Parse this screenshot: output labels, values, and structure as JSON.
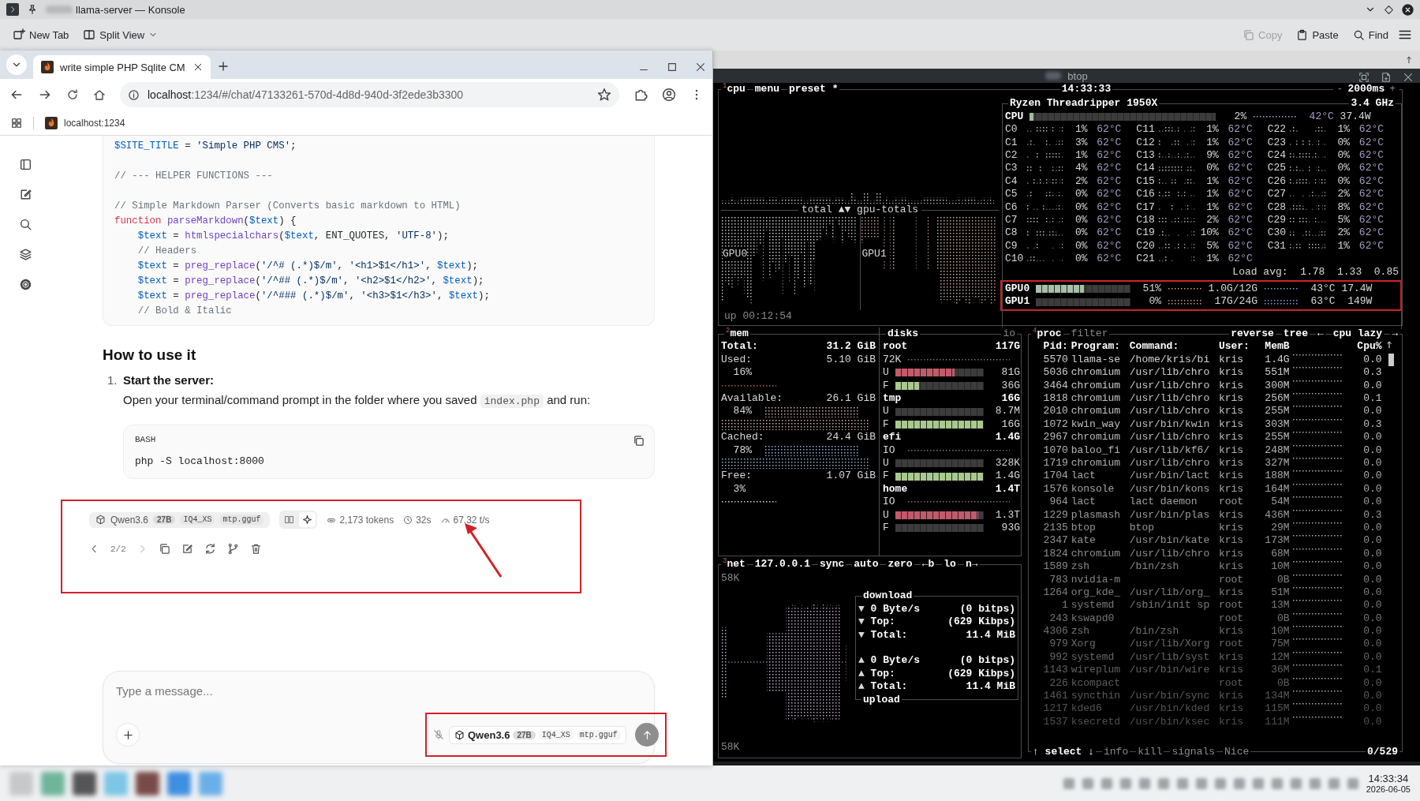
{
  "konsole": {
    "title": "llama-server — Konsole",
    "toolbar": [
      {
        "label": "New Tab",
        "kind": "new-tab"
      },
      {
        "label": "Split View",
        "kind": "split"
      }
    ],
    "actions": [
      {
        "label": "Copy",
        "kind": "copy",
        "disabled": true
      },
      {
        "label": "Paste",
        "kind": "paste",
        "disabled": false
      },
      {
        "label": "Find",
        "kind": "search",
        "disabled": false
      }
    ]
  },
  "browser": {
    "tabs": [
      {
        "title": "write simple PHP Sqlite CM",
        "selected": true
      }
    ],
    "url_host": "localhost",
    "url_path": ":1234/#/chat/47133261-570d-4d8d-940d-3f2ede3b3300",
    "bookmarks": [
      {
        "label": "localhost:1234"
      }
    ]
  },
  "sidebar": [
    {
      "kind": "panel"
    },
    {
      "kind": "edit"
    },
    {
      "kind": "search"
    },
    {
      "kind": "models"
    },
    {
      "kind": "settings"
    }
  ],
  "chat": {
    "code_lines": [
      {
        "kind": "code",
        "indented": false,
        "segments": [
          {
            "kind": "var",
            "t": "$SITE_TITLE"
          },
          {
            "kind": "p",
            "t": " = "
          },
          {
            "kind": "str",
            "t": "'Simple PHP CMS'"
          },
          {
            "kind": "p",
            "t": ";"
          }
        ]
      },
      {
        "kind": "blank"
      },
      {
        "kind": "code",
        "indented": false,
        "segments": [
          {
            "kind": "cm",
            "t": "// --- HELPER FUNCTIONS ---"
          }
        ]
      },
      {
        "kind": "blank"
      },
      {
        "kind": "code",
        "indented": false,
        "segments": [
          {
            "kind": "cm",
            "t": "// Simple Markdown Parser (Converts basic markdown to HTML)"
          }
        ]
      },
      {
        "kind": "code",
        "indented": false,
        "segments": [
          {
            "kind": "kw",
            "t": "function"
          },
          {
            "kind": "fn",
            "t": " parseMarkdown"
          },
          {
            "kind": "p",
            "t": "("
          },
          {
            "kind": "var",
            "t": "$text"
          },
          {
            "kind": "p",
            "t": ") {"
          }
        ]
      },
      {
        "kind": "code",
        "indented": true,
        "segments": [
          {
            "kind": "var",
            "t": "$text"
          },
          {
            "kind": "p",
            "t": " = "
          },
          {
            "kind": "fn",
            "t": "htmlspecialchars"
          },
          {
            "kind": "p",
            "t": "("
          },
          {
            "kind": "var",
            "t": "$text"
          },
          {
            "kind": "p",
            "t": ", ENT_QUOTES, "
          },
          {
            "kind": "str",
            "t": "'UTF-8'"
          },
          {
            "kind": "p",
            "t": ");"
          }
        ]
      },
      {
        "kind": "code",
        "indented": true,
        "segments": [
          {
            "kind": "cm",
            "t": "// Headers"
          }
        ]
      },
      {
        "kind": "code",
        "indented": true,
        "segments": [
          {
            "kind": "var",
            "t": "$text"
          },
          {
            "kind": "p",
            "t": " = "
          },
          {
            "kind": "fn",
            "t": "preg_replace"
          },
          {
            "kind": "p",
            "t": "("
          },
          {
            "kind": "str",
            "t": "'/^# (.*)$/m'"
          },
          {
            "kind": "p",
            "t": ", "
          },
          {
            "kind": "str",
            "t": "'<h1>$1</h1>'"
          },
          {
            "kind": "p",
            "t": ", "
          },
          {
            "kind": "var",
            "t": "$text"
          },
          {
            "kind": "p",
            "t": ");"
          }
        ]
      },
      {
        "kind": "code",
        "indented": true,
        "segments": [
          {
            "kind": "var",
            "t": "$text"
          },
          {
            "kind": "p",
            "t": " = "
          },
          {
            "kind": "fn",
            "t": "preg_replace"
          },
          {
            "kind": "p",
            "t": "("
          },
          {
            "kind": "str",
            "t": "'/^## (.*)$/m'"
          },
          {
            "kind": "p",
            "t": ", "
          },
          {
            "kind": "str",
            "t": "'<h2>$1</h2>'"
          },
          {
            "kind": "p",
            "t": ", "
          },
          {
            "kind": "var",
            "t": "$text"
          },
          {
            "kind": "p",
            "t": ");"
          }
        ]
      },
      {
        "kind": "code",
        "indented": true,
        "segments": [
          {
            "kind": "var",
            "t": "$text"
          },
          {
            "kind": "p",
            "t": " = "
          },
          {
            "kind": "fn",
            "t": "preg_replace"
          },
          {
            "kind": "p",
            "t": "("
          },
          {
            "kind": "str",
            "t": "'/^### (.*)$/m'"
          },
          {
            "kind": "p",
            "t": ", "
          },
          {
            "kind": "str",
            "t": "'<h3>$1</h3>'"
          },
          {
            "kind": "p",
            "t": ", "
          },
          {
            "kind": "var",
            "t": "$text"
          },
          {
            "kind": "p",
            "t": ");"
          }
        ]
      },
      {
        "kind": "code",
        "indented": true,
        "segments": [
          {
            "kind": "cm",
            "t": "// Bold & Italic"
          }
        ]
      }
    ],
    "heading": "How to use it",
    "steps": [
      {
        "number": "1.",
        "title": "Start the server:",
        "text_before": "Open your terminal/command prompt in the folder where you saved",
        "code": "index.php",
        "text_after": "and run:",
        "block": {
          "language": "BASH",
          "code": "php -S localhost:8000"
        }
      }
    ],
    "message_info": {
      "model": {
        "name": "Qwen3.6",
        "size": "27B",
        "tags": [
          "IQ4_XS",
          "mtp.gguf"
        ]
      },
      "toggles": [
        {
          "kind": "book",
          "selected": false
        },
        {
          "kind": "sparkle",
          "selected": true
        }
      ],
      "stats": [
        {
          "kind": "tokens",
          "text": "2,173 tokens"
        },
        {
          "kind": "clock",
          "text": "32s"
        },
        {
          "kind": "gauge",
          "text": "67.32 t/s"
        }
      ],
      "pager": "2/2",
      "actions": [
        {
          "kind": "copy"
        },
        {
          "kind": "edit"
        },
        {
          "kind": "regen"
        },
        {
          "kind": "branch"
        },
        {
          "kind": "trash"
        }
      ]
    },
    "composer": {
      "placeholder": "Type a message...",
      "model": {
        "name": "Qwen3.6",
        "size": "27B",
        "tags": [
          "IQ4_XS",
          "mtp.gguf"
        ]
      }
    }
  },
  "taskbar": {
    "time": "14:33:34",
    "date": "2026-06-05"
  },
  "btop": {
    "window_title": "btop",
    "cpu": {
      "number": "1",
      "title": "cpu",
      "menu": [
        "menu",
        "preset *"
      ],
      "clock": "14:33:33",
      "interval": [
        "-",
        "2000ms",
        "+"
      ],
      "graph_label": "total ▲▼ gpu-totals",
      "gpu_graphs": [
        "GPU0",
        "GPU1"
      ],
      "uptime": "up 00:12:54",
      "model": "Ryzen Threadripper 1950X",
      "freq": "3.4 GHz",
      "total": {
        "label": "CPU",
        "level": 0.02,
        "percent": "2%",
        "temp": "42°C",
        "power": "37.4W"
      },
      "cores": [
        {
          "name": "C0",
          "percent": "1%",
          "temp": "62°C"
        },
        {
          "name": "C1",
          "percent": "3%",
          "temp": "62°C"
        },
        {
          "name": "C2",
          "percent": "1%",
          "temp": "62°C"
        },
        {
          "name": "C3",
          "percent": "4%",
          "temp": "62°C"
        },
        {
          "name": "C4",
          "percent": "2%",
          "temp": "62°C"
        },
        {
          "name": "C5",
          "percent": "0%",
          "temp": "62°C"
        },
        {
          "name": "C6",
          "percent": "0%",
          "temp": "62°C"
        },
        {
          "name": "C7",
          "percent": "0%",
          "temp": "62°C"
        },
        {
          "name": "C8",
          "percent": "0%",
          "temp": "62°C"
        },
        {
          "name": "C9",
          "percent": "0%",
          "temp": "62°C"
        },
        {
          "name": "C10",
          "percent": "0%",
          "temp": "62°C"
        },
        {
          "name": "C11",
          "percent": "1%",
          "temp": "62°C"
        },
        {
          "name": "C12",
          "percent": "1%",
          "temp": "62°C"
        },
        {
          "name": "C13",
          "percent": "9%",
          "temp": "62°C"
        },
        {
          "name": "C14",
          "percent": "0%",
          "temp": "62°C"
        },
        {
          "name": "C15",
          "percent": "1%",
          "temp": "62°C"
        },
        {
          "name": "C16",
          "percent": "1%",
          "temp": "62°C"
        },
        {
          "name": "C17",
          "percent": "1%",
          "temp": "62°C"
        },
        {
          "name": "C18",
          "percent": "2%",
          "temp": "62°C"
        },
        {
          "name": "C19",
          "percent": "10%",
          "temp": "62°C"
        },
        {
          "name": "C20",
          "percent": "5%",
          "temp": "62°C"
        },
        {
          "name": "C21",
          "percent": "1%",
          "temp": "62°C"
        },
        {
          "name": "C22",
          "percent": "1%",
          "temp": "62°C"
        },
        {
          "name": "C23",
          "percent": "0%",
          "temp": "62°C"
        },
        {
          "name": "C24",
          "percent": "0%",
          "temp": "62°C"
        },
        {
          "name": "C25",
          "percent": "0%",
          "temp": "62°C"
        },
        {
          "name": "C26",
          "percent": "0%",
          "temp": "62°C"
        },
        {
          "name": "C27",
          "percent": "2%",
          "temp": "62°C"
        },
        {
          "name": "C28",
          "percent": "8%",
          "temp": "62°C"
        },
        {
          "name": "C29",
          "percent": "5%",
          "temp": "62°C"
        },
        {
          "name": "C30",
          "percent": "2%",
          "temp": "62°C"
        },
        {
          "name": "C31",
          "percent": "1%",
          "temp": "62°C"
        }
      ],
      "load_avg": "Load avg:  1.78  1.33  0.85",
      "gpus": [
        {
          "name": "GPU0",
          "level": 0.51,
          "percent": "51%",
          "mem": "1.0G/12G",
          "temp": "43°C",
          "power": "17.4W"
        },
        {
          "name": "GPU1",
          "level": 0,
          "percent": "0%",
          "mem": "17G/24G",
          "temp": "63°C",
          "power": "149W"
        }
      ]
    },
    "mem": {
      "number": "2",
      "title": "mem",
      "items": [
        {
          "kind": "total",
          "label": "Total:",
          "value": "31.2 GiB"
        },
        {
          "kind": "used",
          "label": "Used:",
          "value": "5.10 GiB",
          "percent": "16%"
        },
        {
          "kind": "available",
          "label": "Available:",
          "value": "26.1 GiB",
          "percent": "84%"
        },
        {
          "kind": "cached",
          "label": "Cached:",
          "value": "24.4 GiB",
          "percent": "78%"
        },
        {
          "kind": "free",
          "label": "Free:",
          "value": "1.07 GiB",
          "percent": "3%"
        }
      ]
    },
    "disks": {
      "title": "disks",
      "io_label": "io",
      "items": [
        {
          "name": "root",
          "size": "117G",
          "io": "72K",
          "used": {
            "label": "U",
            "level": 0.67,
            "value": "81G"
          },
          "free": {
            "label": "F",
            "level": 0.27,
            "value": "36G"
          }
        },
        {
          "name": "tmp",
          "size": "16G",
          "used": {
            "label": "U",
            "level": 0,
            "value": "8.7M"
          },
          "free": {
            "label": "F",
            "level": 1,
            "value": "16G"
          }
        },
        {
          "name": "efi",
          "size": "1.4G",
          "io": "IO",
          "used": {
            "label": "U",
            "level": 0,
            "value": "328K"
          },
          "free": {
            "label": "F",
            "level": 1,
            "value": "1.4G"
          }
        },
        {
          "name": "home",
          "size": "1.4T",
          "io": "IO",
          "used": {
            "label": "U",
            "level": 0.94,
            "value": "1.3T"
          },
          "free": {
            "label": "F",
            "level": 0,
            "value": "93G"
          }
        }
      ]
    },
    "net": {
      "number": "3",
      "title": "net",
      "tabs": [
        "127.0.0.1",
        "sync",
        "auto",
        "zero",
        "←b",
        "lo",
        "n→"
      ],
      "scale_top": "58K",
      "scale_bottom": "58K",
      "download_title": "download",
      "upload_title": "upload",
      "download": [
        {
          "arrow": "▼",
          "label": "0 Byte/s",
          "value": "(0 bitps)"
        },
        {
          "arrow": "▼",
          "label": "Top:",
          "value": "(629 Kibps)"
        },
        {
          "arrow": "▼",
          "label": "Total:",
          "value": "11.4 MiB"
        }
      ],
      "upload": [
        {
          "arrow": "▲",
          "label": "0 Byte/s",
          "value": "(0 bitps)"
        },
        {
          "arrow": "▲",
          "label": "Top:",
          "value": "(629 Kibps)"
        },
        {
          "arrow": "▲",
          "label": "Total:",
          "value": "11.4 MiB"
        }
      ]
    },
    "proc": {
      "number": "4",
      "title": "proc",
      "filter": "filter",
      "options": [
        "reverse",
        "tree",
        "←",
        "cpu lazy",
        "→"
      ],
      "columns": [
        "Pid:",
        "Program:",
        "Command:",
        "User:",
        "MemB",
        "Cpu%"
      ],
      "rows": [
        {
          "pid": "5570",
          "program": "llama-se",
          "command": "/home/kris/bi",
          "user": "kris",
          "mem": "1.4G",
          "cpu": "0.0"
        },
        {
          "pid": "5036",
          "program": "chromium",
          "command": "/usr/lib/chro",
          "user": "kris",
          "mem": "551M",
          "cpu": "0.3"
        },
        {
          "pid": "3464",
          "program": "chromium",
          "command": "/usr/lib/chro",
          "user": "kris",
          "mem": "300M",
          "cpu": "0.0"
        },
        {
          "pid": "1818",
          "program": "chromium",
          "command": "/usr/lib/chro",
          "user": "kris",
          "mem": "256M",
          "cpu": "0.1"
        },
        {
          "pid": "2010",
          "program": "chromium",
          "command": "/usr/lib/chro",
          "user": "kris",
          "mem": "255M",
          "cpu": "0.0"
        },
        {
          "pid": "1072",
          "program": "kwin_way",
          "command": "/usr/bin/kwin",
          "user": "kris",
          "mem": "303M",
          "cpu": "0.3"
        },
        {
          "pid": "2967",
          "program": "chromium",
          "command": "/usr/lib/chro",
          "user": "kris",
          "mem": "255M",
          "cpu": "0.0"
        },
        {
          "pid": "1070",
          "program": "baloo_fi",
          "command": "/usr/lib/kf6/",
          "user": "kris",
          "mem": "248M",
          "cpu": "0.0"
        },
        {
          "pid": "1719",
          "program": "chromium",
          "command": "/usr/lib/chro",
          "user": "kris",
          "mem": "327M",
          "cpu": "0.0"
        },
        {
          "pid": "1704",
          "program": "lact",
          "command": "/usr/bin/lact",
          "user": "kris",
          "mem": "188M",
          "cpu": "0.0"
        },
        {
          "pid": "1576",
          "program": "konsole",
          "command": "/usr/bin/kons",
          "user": "kris",
          "mem": "164M",
          "cpu": "0.0"
        },
        {
          "pid": "964",
          "program": "lact",
          "command": "lact daemon",
          "user": "root",
          "mem": "54M",
          "cpu": "0.0"
        },
        {
          "pid": "1229",
          "program": "plasmash",
          "command": "/usr/bin/plas",
          "user": "kris",
          "mem": "436M",
          "cpu": "0.3"
        },
        {
          "pid": "2135",
          "program": "btop",
          "command": "btop",
          "user": "kris",
          "mem": "29M",
          "cpu": "0.0"
        },
        {
          "pid": "2347",
          "program": "kate",
          "command": "/usr/bin/kate",
          "user": "kris",
          "mem": "173M",
          "cpu": "0.0"
        },
        {
          "pid": "1824",
          "program": "chromium",
          "command": "/usr/lib/chro",
          "user": "kris",
          "mem": "68M",
          "cpu": "0.0"
        },
        {
          "pid": "1589",
          "program": "zsh",
          "command": "/bin/zsh",
          "user": "kris",
          "mem": "10M",
          "cpu": "0.0"
        },
        {
          "pid": "783",
          "program": "nvidia-m",
          "user": "root",
          "mem": "0B",
          "cpu": "0.0"
        },
        {
          "pid": "1264",
          "program": "org_kde_",
          "command": "/usr/lib/org_",
          "user": "kris",
          "mem": "51M",
          "cpu": "0.0"
        },
        {
          "pid": "1",
          "program": "systemd",
          "command": "/sbin/init sp",
          "user": "root",
          "mem": "13M",
          "cpu": "0.0"
        },
        {
          "pid": "243",
          "program": "kswapd0",
          "user": "root",
          "mem": "0B",
          "cpu": "0.0"
        },
        {
          "pid": "4306",
          "program": "zsh",
          "command": "/bin/zsh",
          "user": "kris",
          "mem": "10M",
          "cpu": "0.0"
        },
        {
          "pid": "979",
          "program": "Xorg",
          "command": "/usr/lib/Xorg",
          "user": "root",
          "mem": "75M",
          "cpu": "0.0"
        },
        {
          "pid": "992",
          "program": "systemd",
          "command": "/usr/lib/syst",
          "user": "kris",
          "mem": "12M",
          "cpu": "0.0"
        },
        {
          "pid": "1143",
          "program": "wireplum",
          "command": "/usr/bin/wire",
          "user": "kris",
          "mem": "36M",
          "cpu": "0.1"
        },
        {
          "pid": "226",
          "program": "kcompact",
          "user": "root",
          "mem": "0B",
          "cpu": "0.0"
        },
        {
          "pid": "1461",
          "program": "syncthin",
          "command": "/usr/bin/sync",
          "user": "kris",
          "mem": "134M",
          "cpu": "0.0"
        },
        {
          "pid": "1217",
          "program": "kded6",
          "command": "/usr/bin/kded",
          "user": "kris",
          "mem": "115M",
          "cpu": "0.0"
        },
        {
          "pid": "1537",
          "program": "ksecretd",
          "command": "/usr/bin/ksec",
          "user": "kris",
          "mem": "111M",
          "cpu": "0.0"
        }
      ],
      "footer": [
        "↑ select ↓",
        "info",
        "kill",
        "signals",
        "Nice"
      ],
      "count": "0/529"
    }
  }
}
